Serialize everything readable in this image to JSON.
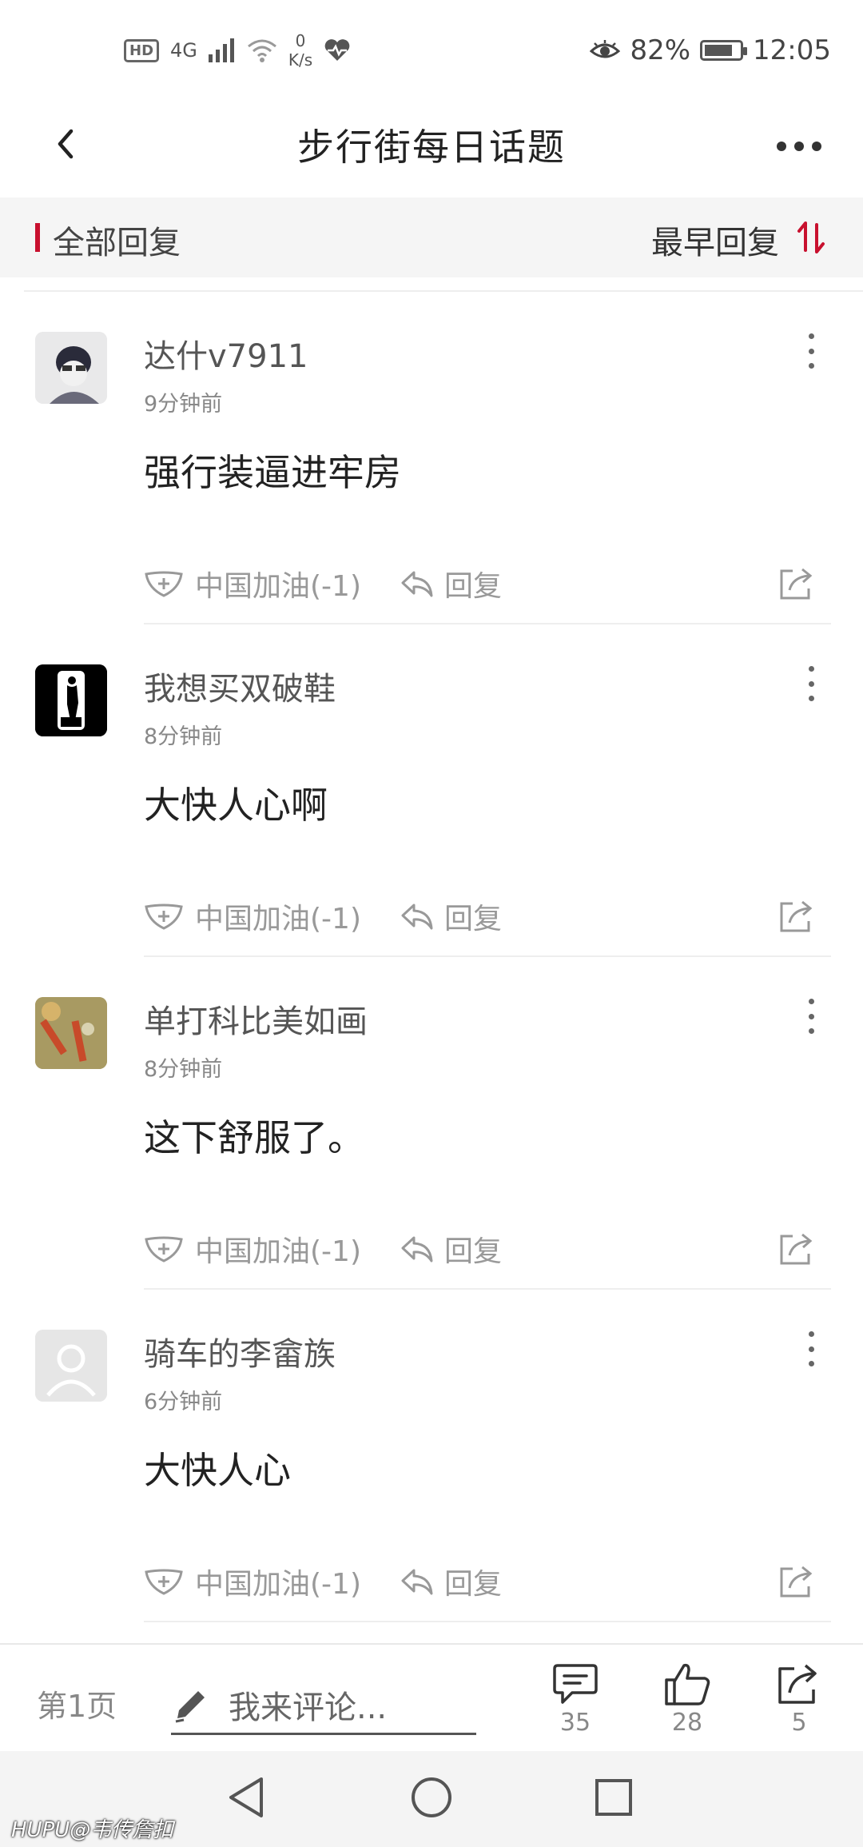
{
  "status_bar": {
    "hd": "HD",
    "network": "4G",
    "speed_value": "0",
    "speed_unit": "K/s",
    "battery_text": "82%",
    "battery_level": 0.82,
    "time": "12:05"
  },
  "nav": {
    "title": "步行街每日话题"
  },
  "filter": {
    "all_replies": "全部回复",
    "sort_label": "最早回复",
    "accent_color": "#c8102e"
  },
  "comments": [
    {
      "user": "达什v7911",
      "time": "9分钟前",
      "text": "强行装逼进牢房",
      "cheer": "中国加油(-1)",
      "reply": "回复"
    },
    {
      "user": "我想买双破鞋",
      "time": "8分钟前",
      "text": "大快人心啊",
      "cheer": "中国加油(-1)",
      "reply": "回复"
    },
    {
      "user": "单打科比美如画",
      "time": "8分钟前",
      "text": "这下舒服了。",
      "cheer": "中国加油(-1)",
      "reply": "回复"
    },
    {
      "user": "骑车的李畲族",
      "time": "6分钟前",
      "text": "大快人心",
      "cheer": "中国加油(-1)",
      "reply": "回复"
    }
  ],
  "bottom_bar": {
    "page": "第1页",
    "input_placeholder": "我来评论...",
    "comments_count": "35",
    "likes_count": "28",
    "shares_count": "5"
  },
  "watermark": {
    "brand": "HUPU",
    "handle": "@韦传詹扣"
  }
}
